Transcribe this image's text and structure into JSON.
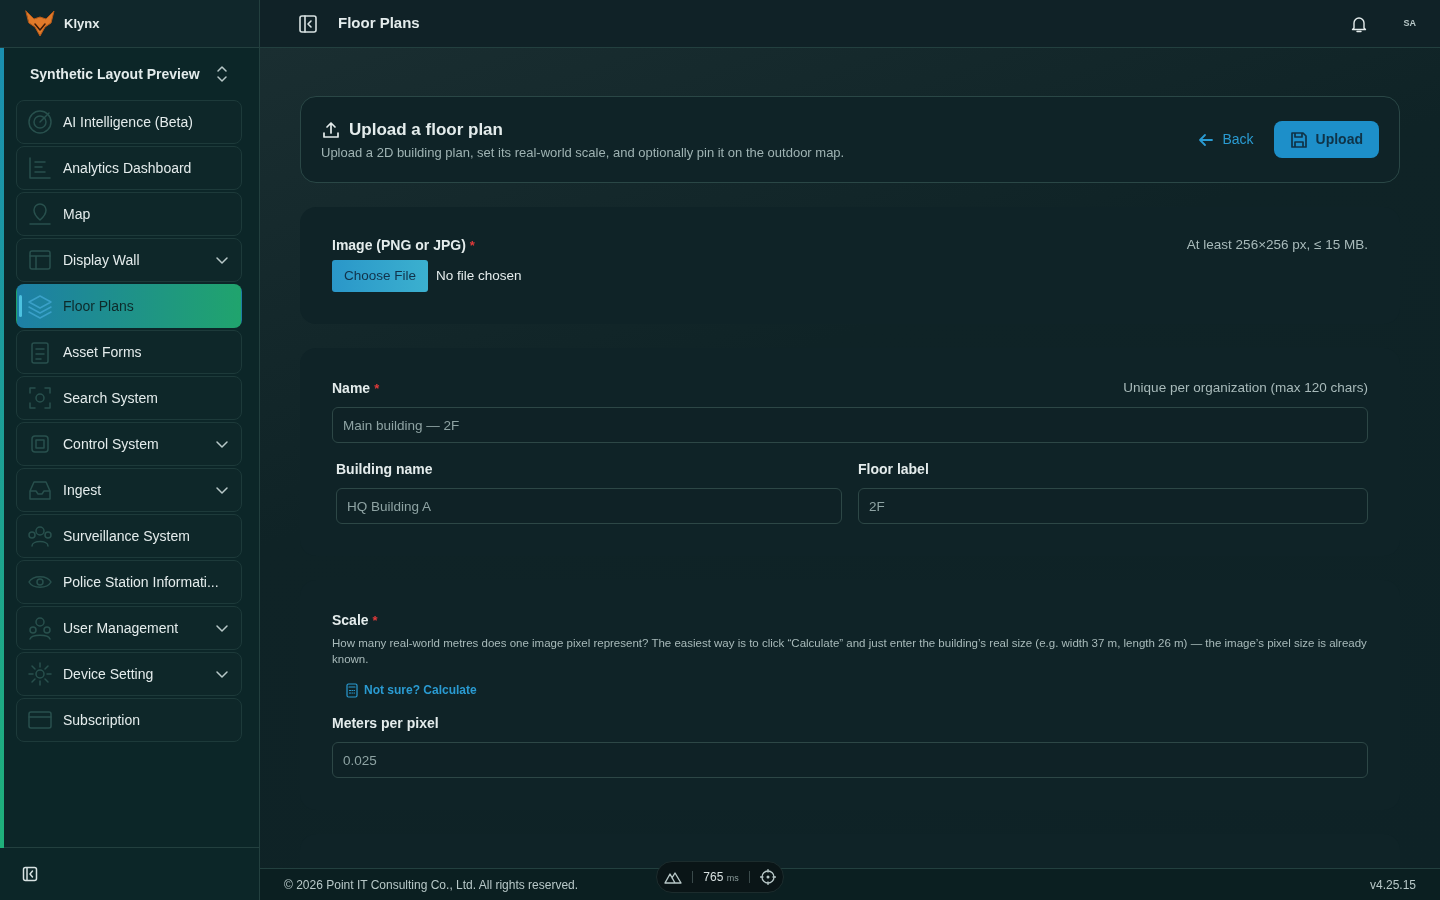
{
  "brand": {
    "name": "Klynx"
  },
  "workspace": {
    "name": "Synthetic Layout Preview"
  },
  "sidebar": {
    "items": [
      {
        "label": "AI Intelligence (Beta)",
        "expandable": false,
        "selected": false
      },
      {
        "label": "Analytics Dashboard",
        "expandable": false,
        "selected": false
      },
      {
        "label": "Map",
        "expandable": false,
        "selected": false
      },
      {
        "label": "Display Wall",
        "expandable": true,
        "selected": false
      },
      {
        "label": "Floor Plans",
        "expandable": false,
        "selected": true
      },
      {
        "label": "Asset Forms",
        "expandable": false,
        "selected": false
      },
      {
        "label": "Search System",
        "expandable": false,
        "selected": false
      },
      {
        "label": "Control System",
        "expandable": true,
        "selected": false
      },
      {
        "label": "Ingest",
        "expandable": true,
        "selected": false
      },
      {
        "label": "Surveillance System",
        "expandable": false,
        "selected": false
      },
      {
        "label": "Police Station Informati...",
        "expandable": false,
        "selected": false
      },
      {
        "label": "User Management",
        "expandable": true,
        "selected": false
      },
      {
        "label": "Device Setting",
        "expandable": true,
        "selected": false
      },
      {
        "label": "Subscription",
        "expandable": false,
        "selected": false
      }
    ]
  },
  "header": {
    "title": "Floor Plans",
    "avatar": "SA"
  },
  "intro": {
    "title": "Upload a floor plan",
    "subtitle": "Upload a 2D building plan, set its real-world scale, and optionally pin it on the outdoor map.",
    "back": "Back",
    "upload": "Upload"
  },
  "image_section": {
    "label": "Image (PNG or JPG)",
    "required_mark": "*",
    "hint": "At least 256×256 px, ≤ 15 MB.",
    "choose": "Choose File",
    "status": "No file chosen"
  },
  "name_section": {
    "label": "Name",
    "required_mark": "*",
    "hint": "Unique per organization (max 120 chars)",
    "placeholder": "Main building — 2F",
    "building": {
      "label": "Building name",
      "placeholder": "HQ Building A"
    },
    "floor": {
      "label": "Floor label",
      "placeholder": "2F"
    }
  },
  "scale_section": {
    "label": "Scale",
    "required_mark": "*",
    "help": "How many real-world metres does one image pixel represent? The easiest way is to click “Calculate” and just enter the building’s real size (e.g. width 37 m, length 26 m) — the image’s pixel size is already known.",
    "calculate": "Not sure? Calculate",
    "mpp_label": "Meters per pixel",
    "mpp_placeholder": "0.025"
  },
  "footer": {
    "copyright": "© 2026 Point IT Consulting Co., Ltd. All rights reserved.",
    "version": "v4.25.15",
    "perf": "765",
    "perf_unit": "ms"
  }
}
